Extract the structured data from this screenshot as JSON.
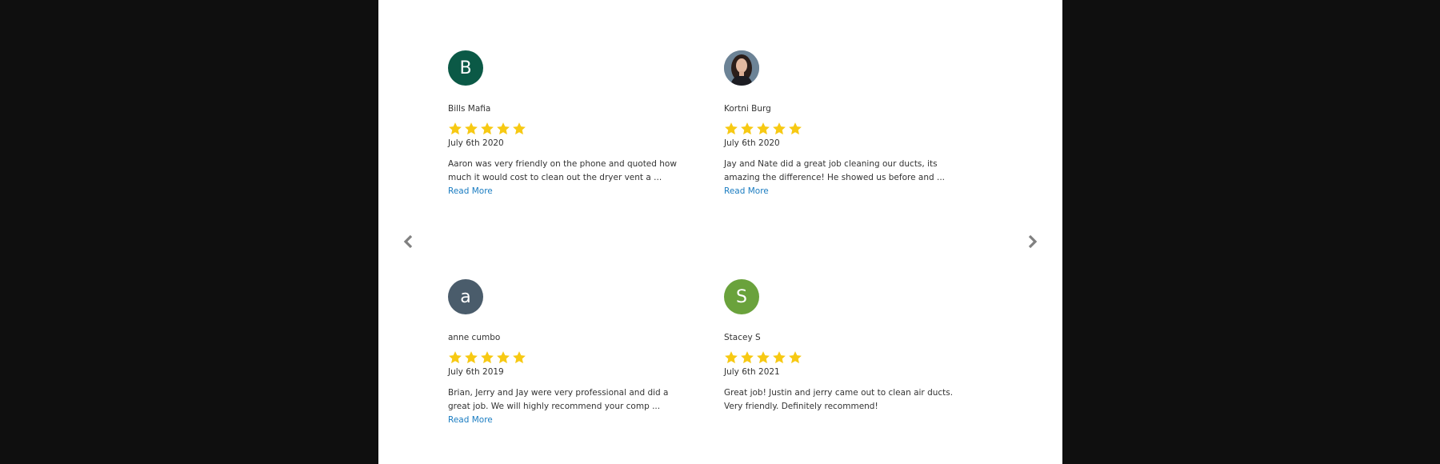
{
  "nav": {
    "prev_icon": "chevron-left-icon",
    "next_icon": "chevron-right-icon",
    "arrow_color": "#808080"
  },
  "star_color": "#f7c913",
  "read_more_label": "Read More",
  "reviews": [
    {
      "author": "Bills Mafia",
      "avatar_letter": "B",
      "avatar_color": "#0b5946",
      "rating": 5,
      "date": "July 6th 2020",
      "text": "Aaron was very friendly on the phone and quoted how much it would cost to clean out the dryer vent a ...",
      "has_read_more": true
    },
    {
      "author": "Kortni Burg",
      "avatar_letter": "",
      "avatar_color": "#5e7486",
      "avatar_is_photo": true,
      "rating": 5,
      "date": "July 6th 2020",
      "text": "Jay and Nate did a great job cleaning our ducts, its amazing the difference! He showed us before and ...",
      "has_read_more": true
    },
    {
      "author": "anne cumbo",
      "avatar_letter": "a",
      "avatar_color": "#4a5c6b",
      "rating": 5,
      "date": "July 6th 2019",
      "text": "Brian, Jerry and Jay were very professional and did a great job. We will highly recommend your comp ...",
      "has_read_more": true
    },
    {
      "author": "Stacey S",
      "avatar_letter": "S",
      "avatar_color": "#6aa23c",
      "rating": 5,
      "date": "July 6th 2021",
      "text": "Great job! Justin and jerry came out to clean air ducts. Very friendly. Definitely recommend!",
      "has_read_more": false
    }
  ]
}
